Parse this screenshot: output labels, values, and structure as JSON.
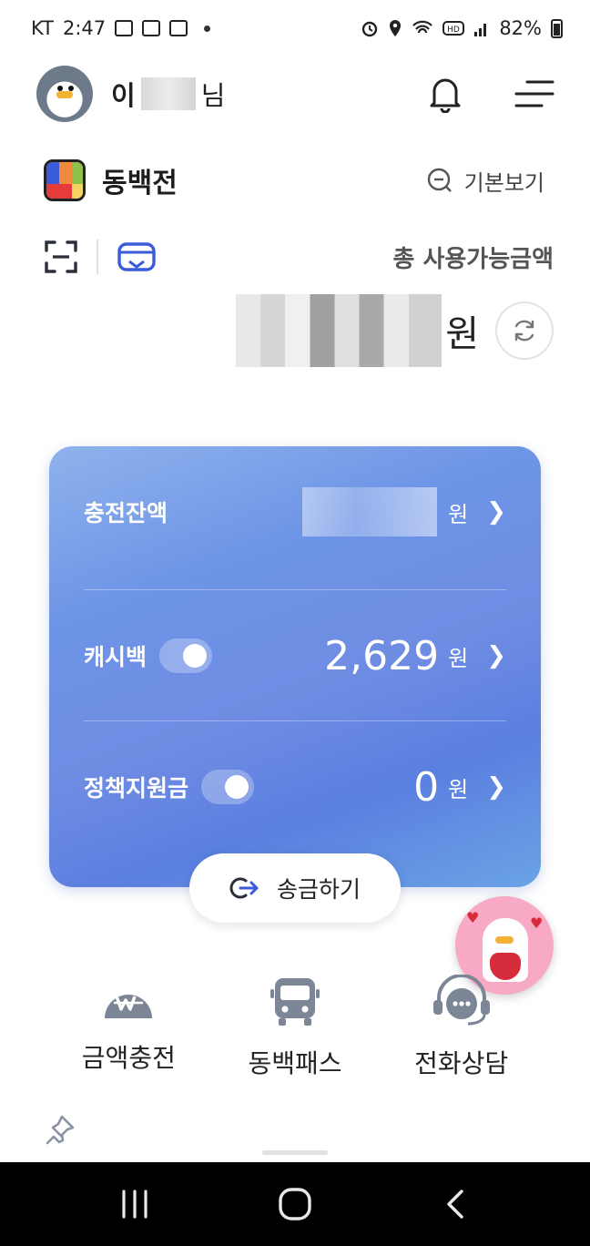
{
  "status_bar": {
    "carrier": "KT",
    "time": "2:47",
    "battery": "82%"
  },
  "header": {
    "name_initial": "이",
    "name_suffix": "님"
  },
  "brand": {
    "name": "동백전",
    "view_toggle_label": "기본보기"
  },
  "balance": {
    "total_label": "총 사용가능금액",
    "unit": "원"
  },
  "card": {
    "accent": "#6d94e6",
    "rows": [
      {
        "label": "충전잔액",
        "value": "",
        "unit": "원",
        "toggle": false
      },
      {
        "label": "캐시백",
        "value": "2,629",
        "unit": "원",
        "toggle": true
      },
      {
        "label": "정책지원금",
        "value": "0",
        "unit": "원",
        "toggle": true
      }
    ]
  },
  "transfer": {
    "label": "송금하기"
  },
  "quick_menu": [
    {
      "label": "금액충전",
      "icon": "won-charge-icon"
    },
    {
      "label": "동백패스",
      "icon": "bus-icon"
    },
    {
      "label": "전화상담",
      "icon": "headset-chat-icon"
    }
  ]
}
